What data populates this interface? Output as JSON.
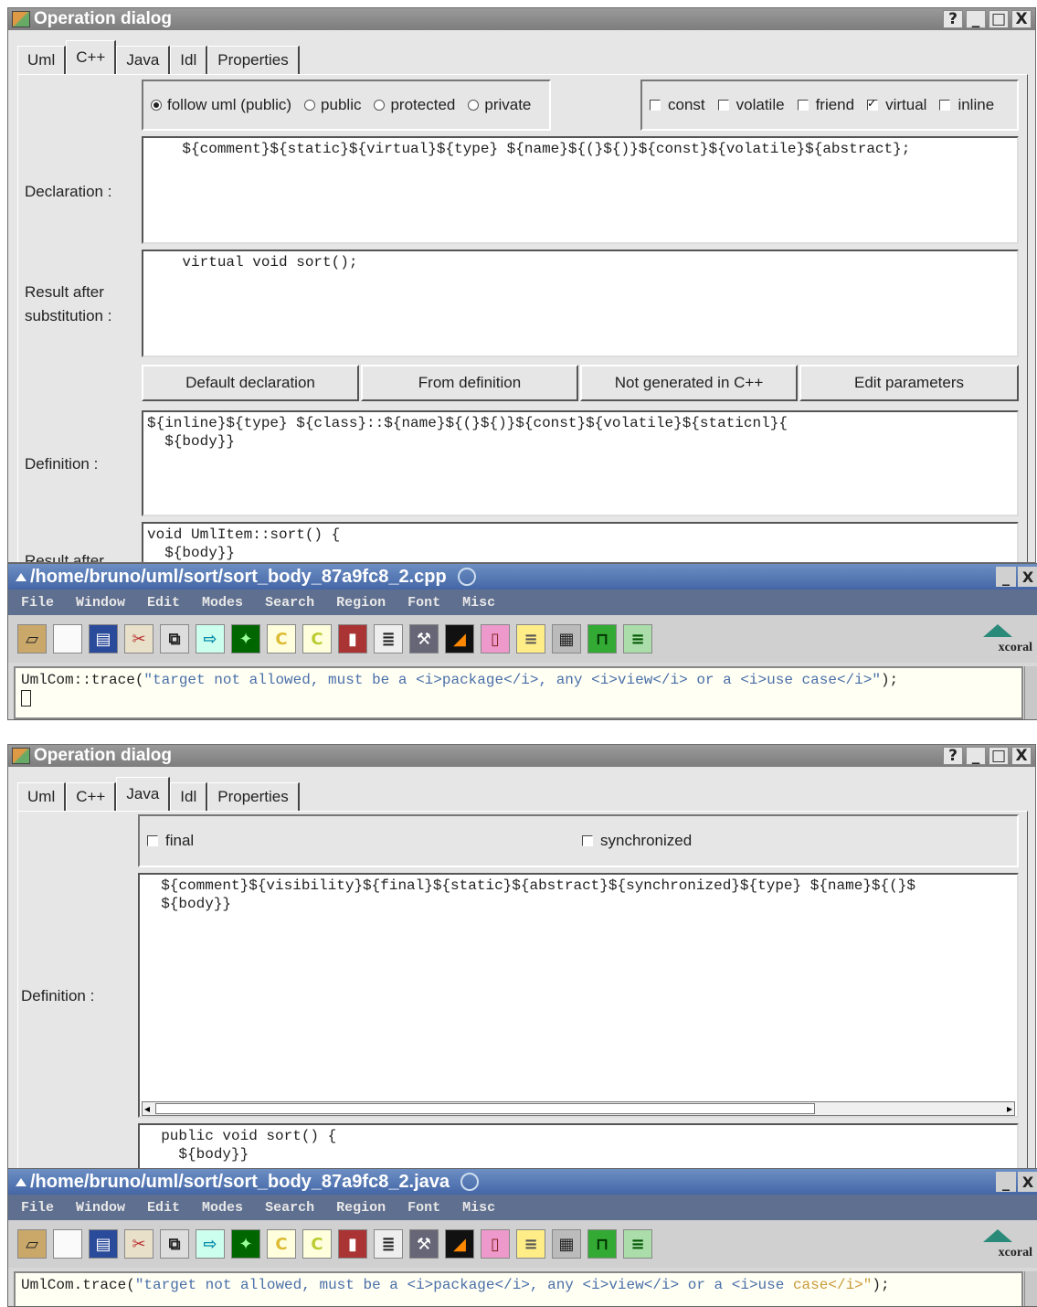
{
  "dialog_cpp": {
    "title": "Operation dialog",
    "title_buttons": [
      "?",
      "_",
      "□",
      "X"
    ],
    "tabs": [
      "Uml",
      "C++",
      "Java",
      "Idl",
      "Properties"
    ],
    "active_tab": "C++",
    "visibility_options": [
      {
        "label": "follow uml (public)",
        "selected": true
      },
      {
        "label": "public",
        "selected": false
      },
      {
        "label": "protected",
        "selected": false
      },
      {
        "label": "private",
        "selected": false
      }
    ],
    "modifiers": [
      {
        "label": "const",
        "checked": false
      },
      {
        "label": "volatile",
        "checked": false
      },
      {
        "label": "friend",
        "checked": false
      },
      {
        "label": "virtual",
        "checked": true
      },
      {
        "label": "inline",
        "checked": false
      }
    ],
    "declaration_label": "Declaration :",
    "declaration_value": "    ${comment}${static}${virtual}${type} ${name}${(}${)}${const}${volatile}${abstract};",
    "result_label_1": "Result after",
    "result_label_2": "substitution :",
    "result_value": "    virtual void sort();",
    "buttons": [
      "Default declaration",
      "From definition",
      "Not generated in C++",
      "Edit parameters"
    ],
    "definition_label": "Definition :",
    "definition_value": "${inline}${type} ${class}::${name}${(}${)}${const}${volatile}${staticnl}{\n  ${body}}",
    "result2_label": "Result after",
    "result2_value": "void UmlItem::sort() {\n  ${body}}"
  },
  "editor_cpp": {
    "title": "/home/bruno/uml/sort/sort_body_87a9fc8_2.cpp",
    "menus": [
      "File",
      "Window",
      "Edit",
      "Modes",
      "Search",
      "Region",
      "Font",
      "Misc"
    ],
    "logo_text": "xcoral",
    "code_prefix": "UmlCom::trace(",
    "code_string": "\"target not allowed, must be a <i>package</i>, any <i>view</i> or a <i>use case</i>\"",
    "code_suffix": ");"
  },
  "dialog_java": {
    "title": "Operation dialog",
    "title_buttons": [
      "?",
      "_",
      "□",
      "X"
    ],
    "tabs": [
      "Uml",
      "C++",
      "Java",
      "Idl",
      "Properties"
    ],
    "active_tab": "Java",
    "modifiers": [
      {
        "label": "final",
        "checked": false
      },
      {
        "label": "synchronized",
        "checked": false
      }
    ],
    "definition_label": "Definition :",
    "definition_value": "  ${comment}${visibility}${final}${static}${abstract}${synchronized}${type} ${name}${(}$\n  ${body}}",
    "result_value": "  public void sort() {\n    ${body}}"
  },
  "editor_java": {
    "title": "/home/bruno/uml/sort/sort_body_87a9fc8_2.java",
    "menus": [
      "File",
      "Window",
      "Edit",
      "Modes",
      "Search",
      "Region",
      "Font",
      "Misc"
    ],
    "logo_text": "xcoral",
    "code_prefix": "UmlCom.trace(",
    "code_string_a": "\"target not allowed, must be a <i>package</i>, any <i>view</i> or a <i>use ",
    "code_string_b": "case</i>\"",
    "code_suffix": ");"
  },
  "colors": {
    "dialog_bg": "#e6e6e6",
    "titlebar": "#8a8a8a",
    "editor_title": "#5577b5",
    "editor_menubar": "#5f6f8f",
    "code_string": "#4a6fa8"
  },
  "toolbar_icons": [
    "open-folder-icon",
    "new-file-icon",
    "save-icon",
    "cut-icon",
    "copy-icon",
    "forward-arrow-icon",
    "star-icon",
    "c-mode-icon",
    "cpp-mode-icon",
    "trash-icon",
    "document-icon",
    "tools-icon",
    "rainbow-icon",
    "book-icon",
    "font-icon",
    "stack-icon",
    "bridge-icon",
    "tree-icon"
  ]
}
